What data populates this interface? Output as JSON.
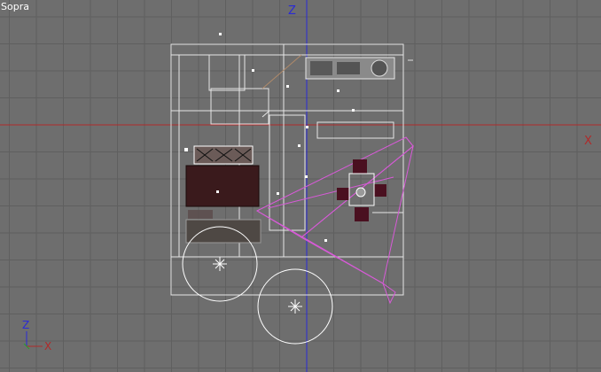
{
  "viewport": {
    "label": "Sopra",
    "colors": {
      "background": "#6e6e6e",
      "grid": "#5e5e5e",
      "z_axis": "#2a2ad0",
      "x_axis": "#b02020",
      "wireframe": "#e6e6e6",
      "selection": "#d85ad8"
    }
  },
  "axes": {
    "vertical_label": "Z",
    "horizontal_label": "X"
  },
  "gizmo": {
    "vertical_label": "Z",
    "horizontal_label": "X"
  }
}
